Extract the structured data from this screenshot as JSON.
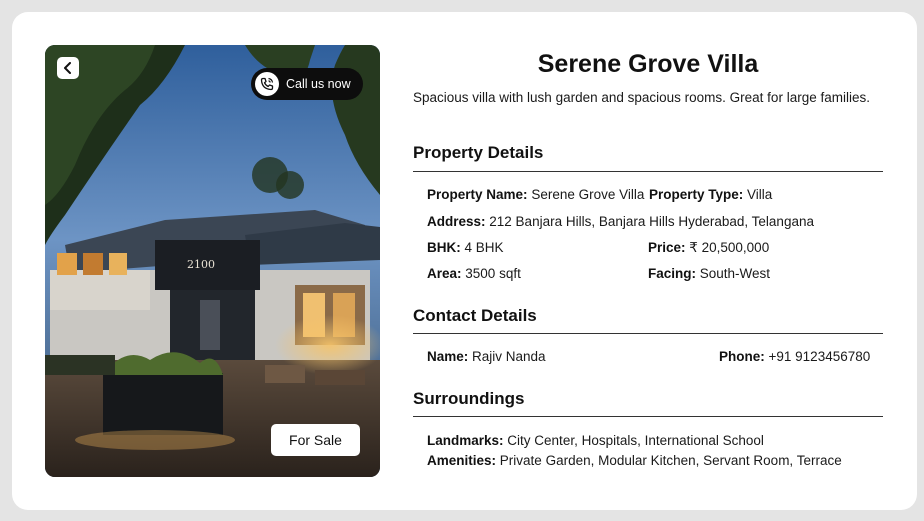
{
  "photo": {
    "back_label": "",
    "call_label": "Call us now",
    "sale_label": "For Sale",
    "sign_text": "2100"
  },
  "property": {
    "title": "Serene Grove Villa",
    "description": "Spacious villa with lush garden and spacious rooms. Great for large families."
  },
  "details": {
    "heading": "Property Details",
    "name_label": "Property Name:",
    "name_value": "Serene Grove Villa",
    "type_label": "Property Type:",
    "type_value": "Villa",
    "address_label": "Address:",
    "address_value": "212 Banjara Hills, Banjara Hills Hyderabad, Telangana",
    "bhk_label": "BHK:",
    "bhk_value": "4 BHK",
    "price_label": "Price:",
    "price_value": "₹ 20,500,000",
    "area_label": "Area:",
    "area_value": "3500 sqft",
    "facing_label": "Facing:",
    "facing_value": "South-West"
  },
  "contact": {
    "heading": "Contact Details",
    "name_label": "Name:",
    "name_value": "Rajiv Nanda",
    "phone_label": "Phone:",
    "phone_value": "+91 9123456780"
  },
  "surroundings": {
    "heading": "Surroundings",
    "landmarks_label": "Landmarks:",
    "landmarks_value": "City Center, Hospitals, International School",
    "amenities_label": "Amenities:",
    "amenities_value": "Private Garden, Modular Kitchen, Servant Room, Terrace"
  },
  "colors": {
    "page_bg": "#e4e4e4",
    "card_bg": "#ffffff",
    "call_button_bg": "#0d0d0d",
    "text": "#111111"
  },
  "icons": [
    "chevron-left-icon",
    "phone-call-icon"
  ]
}
